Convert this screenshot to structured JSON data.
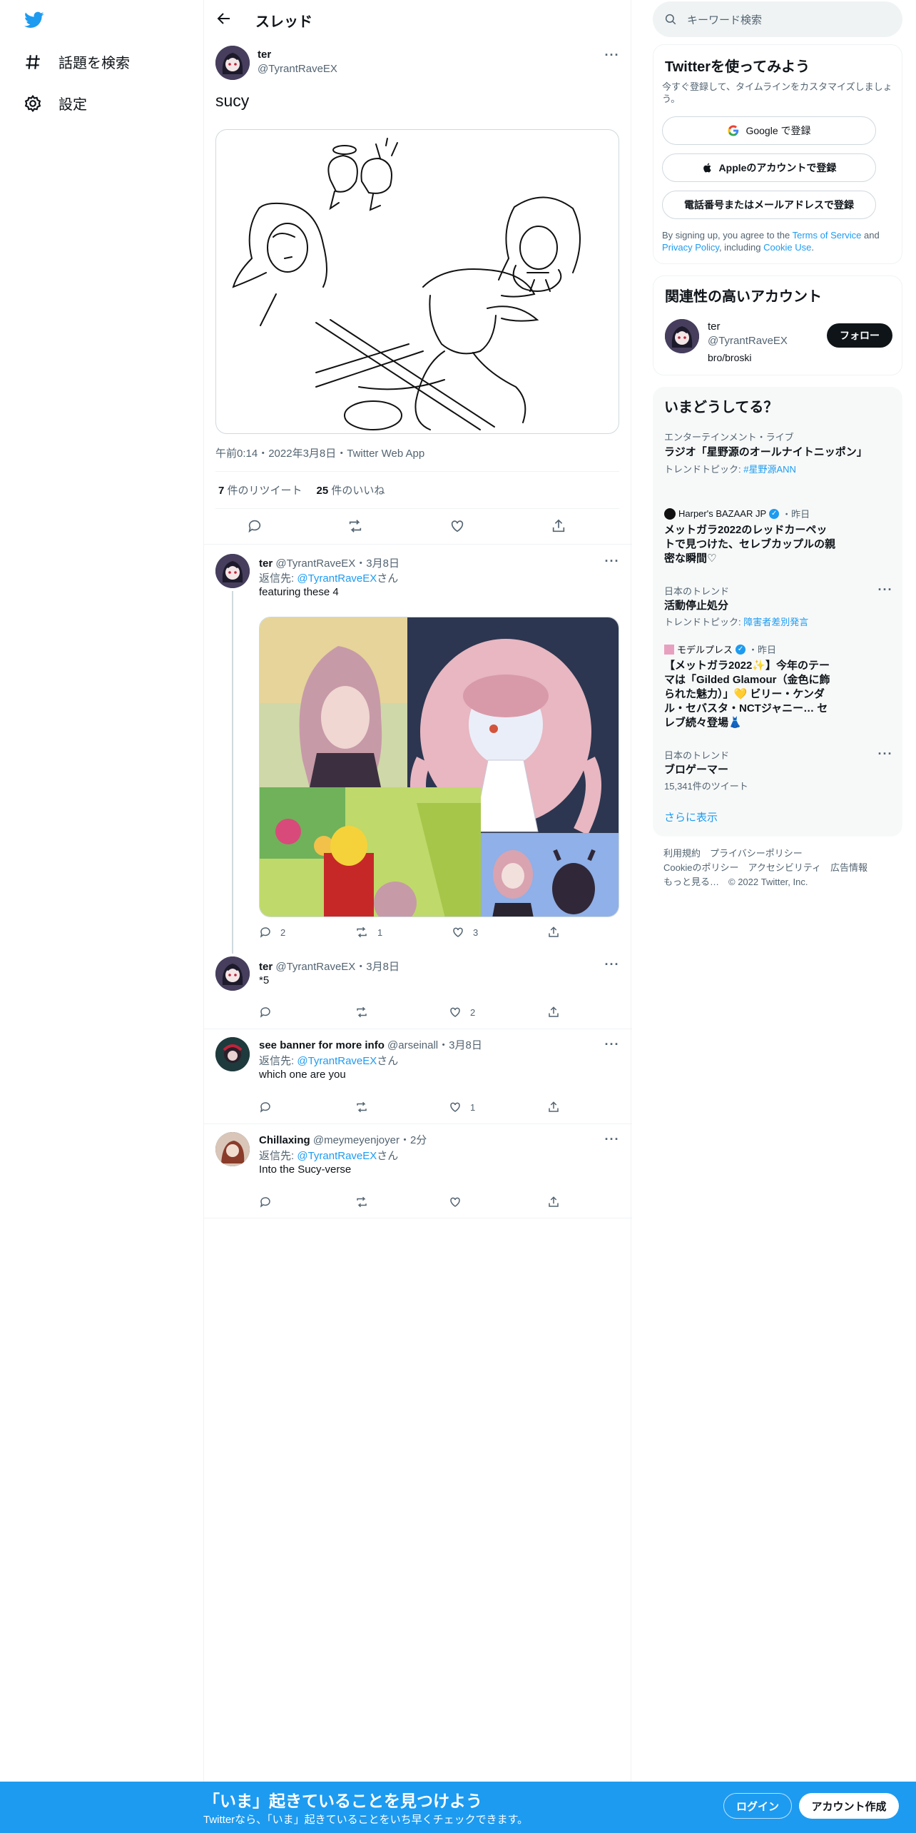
{
  "nav": {
    "explore_label": "話題を検索",
    "settings_label": "設定"
  },
  "header": {
    "title": "スレッド"
  },
  "focus_tweet": {
    "name": "ter",
    "handle": "@TyrantRaveEX",
    "text": "sucy",
    "timestamp": "午前0:14・2022年3月8日・Twitter Web App",
    "retweets_count": "7",
    "retweets_label": " 件のリツイート",
    "likes_count": "25",
    "likes_label": " 件のいいね"
  },
  "replies": [
    {
      "name": "ter",
      "handle": "@TyrantRaveEX",
      "date": "・3月8日",
      "reply_prefix": "返信先: ",
      "reply_to": "@TyrantRaveEX",
      "reply_suffix": "さん",
      "text": "featuring these 4",
      "reply_count": "2",
      "retweet_count": "1",
      "like_count": "3"
    },
    {
      "name": "ter",
      "handle": "@TyrantRaveEX",
      "date": "・3月8日",
      "text": "*5",
      "reply_count": "",
      "retweet_count": "",
      "like_count": "2"
    },
    {
      "name": "see banner for more info",
      "handle": "@arseinall",
      "date": "・3月8日",
      "reply_prefix": "返信先: ",
      "reply_to": "@TyrantRaveEX",
      "reply_suffix": "さん",
      "text": "which one are you",
      "like_count": "1"
    },
    {
      "name": "Chillaxing",
      "handle": "@meymeyenjoyer",
      "date": "・2分",
      "reply_prefix": "返信先: ",
      "reply_to": "@TyrantRaveEX",
      "reply_suffix": "さん",
      "text": "Into the Sucy-verse",
      "like_count": ""
    }
  ],
  "search": {
    "placeholder": "キーワード検索"
  },
  "signup_card": {
    "title": "Twitterを使ってみよう",
    "subtitle": "今すぐ登録して、タイムラインをカスタマイズしましょう。",
    "google_label": "Google で登録",
    "apple_label": "Appleのアカウントで登録",
    "phone_label": "電話番号またはメールアドレスで登録",
    "terms_prefix": "By signing up, you agree to the ",
    "terms_link": "Terms of Service",
    "terms_and": " and ",
    "privacy_link": "Privacy Policy",
    "terms_including": ", including ",
    "cookie_link": "Cookie Use",
    "terms_end": "."
  },
  "relevant": {
    "title": "関連性の高いアカウント",
    "name": "ter",
    "handle": "@TyrantRaveEX",
    "bio": "bro/broski",
    "follow_label": "フォロー"
  },
  "trends": {
    "title": "いまどうしてる？",
    "items": [
      {
        "category": "エンターテインメント・ライブ",
        "title": "ラジオ「星野源のオールナイトニッポン」",
        "sub_prefix": "トレンドトピック: ",
        "sub_link": "#星野源ANN"
      },
      {
        "source": "Harper's BAZAAR JP",
        "time": "・昨日",
        "title": "メットガラ2022のレッドカーペットで見つけた、セレブカップルの親密な瞬間♡"
      },
      {
        "category": "日本のトレンド",
        "title": "活動停止処分",
        "sub_prefix": "トレンドトピック: ",
        "sub_link": "障害者差別発言"
      },
      {
        "source": "モデルプレス",
        "time": "・昨日",
        "title": "【メットガラ2022✨】今年のテーマは「Gilded Glamour（金色に飾られた魅力）」💛 ビリー・ケンダル・セバスタ・NCTジャニー… セレブ続々登場👗"
      },
      {
        "category": "日本のトレンド",
        "title": "ブロゲーマー",
        "sub": "15,341件のツイート"
      }
    ],
    "show_more": "さらに表示"
  },
  "footer": {
    "line1": "利用規約　プライバシーポリシー",
    "line2": "Cookieのポリシー　アクセシビリティ　広告情報",
    "line3": "もっと見る…　© 2022 Twitter, Inc."
  },
  "bottom_bar": {
    "title": "「いま」起きていることを見つけよう",
    "subtitle": "Twitterなら、「いま」起きていることをいち早くチェックできます。",
    "login_label": "ログイン",
    "signup_label": "アカウント作成"
  },
  "colors": {
    "accent": "#1d9bf0",
    "text": "#0f1419",
    "muted": "#536471",
    "border": "#eff3f4"
  }
}
